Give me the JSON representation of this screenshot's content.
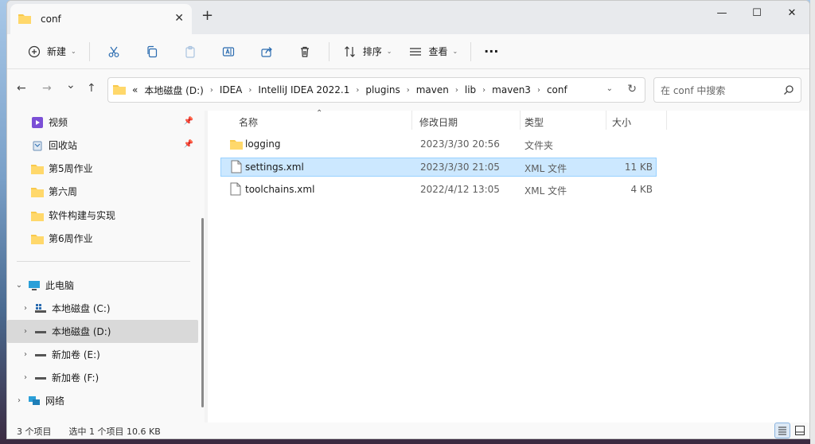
{
  "window": {
    "tab_title": "conf",
    "new_tab": "+",
    "close_tab": "✕"
  },
  "window_controls": {
    "minimize": "—",
    "maximize": "☐",
    "close": "✕"
  },
  "toolbar": {
    "new_label": "新建",
    "sort_label": "排序",
    "view_label": "查看",
    "more": "···"
  },
  "nav": {
    "back": "←",
    "forward": "→",
    "recent": "⌄",
    "up": "↑"
  },
  "address": {
    "overflow": "«",
    "crumbs": [
      "本地磁盘 (D:)",
      "IDEA",
      "IntelliJ IDEA 2022.1",
      "plugins",
      "maven",
      "lib",
      "maven3",
      "conf"
    ]
  },
  "search": {
    "placeholder": "在 conf 中搜索"
  },
  "sidebar": {
    "quick": [
      {
        "label": "视频",
        "icon": "video-icon",
        "pinned": true
      },
      {
        "label": "回收站",
        "icon": "recycle-bin-icon",
        "pinned": true
      },
      {
        "label": "第5周作业",
        "icon": "folder-icon"
      },
      {
        "label": "第六周",
        "icon": "folder-icon"
      },
      {
        "label": "软件构建与实现",
        "icon": "folder-icon"
      },
      {
        "label": "第6周作业",
        "icon": "folder-icon"
      }
    ],
    "this_pc": "此电脑",
    "drives": [
      {
        "label": "本地磁盘 (C:)",
        "icon": "system-drive-icon"
      },
      {
        "label": "本地磁盘 (D:)",
        "icon": "drive-icon",
        "selected": true
      },
      {
        "label": "新加卷 (E:)",
        "icon": "drive-icon"
      },
      {
        "label": "新加卷 (F:)",
        "icon": "drive-icon"
      }
    ],
    "network": "网络"
  },
  "columns": {
    "name": "名称",
    "modified": "修改日期",
    "type": "类型",
    "size": "大小"
  },
  "files": [
    {
      "name": "logging",
      "modified": "2023/3/30 20:56",
      "type": "文件夹",
      "size": "",
      "icon": "folder-icon"
    },
    {
      "name": "settings.xml",
      "modified": "2023/3/30 21:05",
      "type": "XML 文件",
      "size": "11 KB",
      "icon": "file-icon",
      "selected": true
    },
    {
      "name": "toolchains.xml",
      "modified": "2022/4/12 13:05",
      "type": "XML 文件",
      "size": "4 KB",
      "icon": "file-icon"
    }
  ],
  "status": {
    "count": "3 个项目",
    "selected": "选中 1 个项目 10.6 KB"
  },
  "colors": {
    "selection": "#cce8ff",
    "folder": "#f8c94c"
  }
}
